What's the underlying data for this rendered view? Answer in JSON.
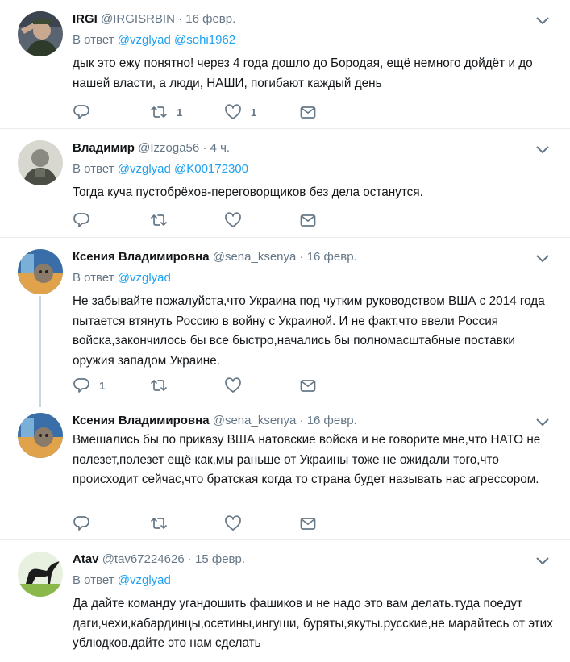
{
  "tweets": [
    {
      "name": "IRGI",
      "handle": "@IRGISRBIN",
      "time": "16 февр.",
      "reply_prefix": "В ответ",
      "mentions": [
        "@vzglyad",
        "@sohi1962"
      ],
      "text": "дык это ежу понятно! через 4 года дошло до Бородая, ещё немного дойдёт и до нашей власти, а люди, НАШИ, погибают каждый день",
      "retweets": "1",
      "likes": "1"
    },
    {
      "name": "Владимир",
      "handle": "@Izzoga56",
      "time": "4 ч.",
      "reply_prefix": "В ответ",
      "mentions": [
        "@vzglyad",
        "@K00172300"
      ],
      "text": "Тогда куча пустобрёхов-переговорщиков без дела останутся.",
      "retweets": "",
      "likes": ""
    },
    {
      "name": "Ксения Владимировна",
      "handle": "@sena_ksenya",
      "time": "16 февр.",
      "reply_prefix": "В ответ",
      "mentions": [
        "@vzglyad"
      ],
      "text": "Не забывайте пожалуйста,что Украина под чутким руководством ВША с 2014 года пытается втянуть Россию в войну с Украиной. И не факт,что ввели Россия войска,закончилось бы все быстро,начались бы полномасштабные поставки оружия западом Украине.",
      "replies": "1",
      "retweets": "",
      "likes": ""
    },
    {
      "name": "Ксения Владимировна",
      "handle": "@sena_ksenya",
      "time": "16 февр.",
      "text": "Вмешались бы по приказу ВША натовские войска и не говорите мне,что НАТО не полезет,полезет ещё как,мы раньше от Украины тоже не ожидали того,что происходит сейчас,что братская когда то страна будет называть нас агрессором."
    },
    {
      "name": "Atav",
      "handle": "@tav67224626",
      "time": "15 февр.",
      "reply_prefix": "В ответ",
      "mentions": [
        "@vzglyad"
      ],
      "text": "Да дайте команду угандошить фашиков и не надо это вам делать.туда поедут даги,чехи,кабардинцы,осетины,ингуши, буряты,якуты.русские,не марайтесь от этих ублюдков.дайте это нам сделать"
    }
  ],
  "separator": "·",
  "colors": {
    "link": "#1da1f2",
    "muted": "#657786",
    "text": "#14171a",
    "border": "#e6ecf0"
  },
  "icons": [
    "reply-icon",
    "retweet-icon",
    "like-icon",
    "message-icon",
    "chevron-down-icon"
  ]
}
